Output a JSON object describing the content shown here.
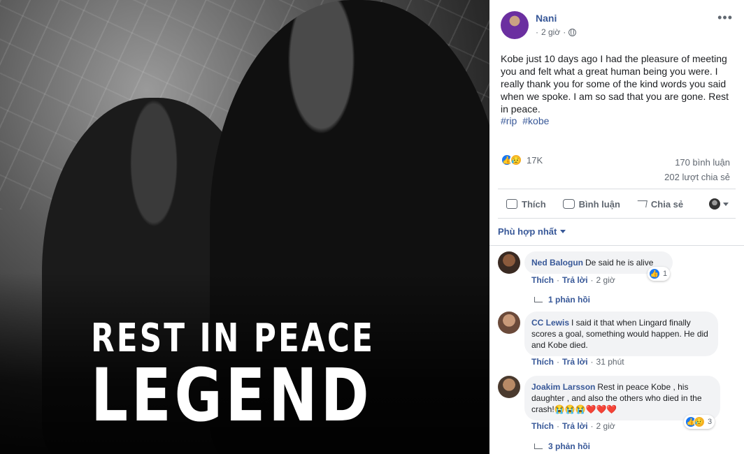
{
  "photo": {
    "line1": "REST IN PEACE",
    "line2": "LEGEND"
  },
  "post": {
    "author": "Nani",
    "time": "2 giờ",
    "more": "•••",
    "text": "Kobe just 10 days ago I had the pleasure of meeting you and felt what a great human being you were. I really thank you for some of the kind words you said when we spoke. I am so sad that you are gone. Rest in peace.",
    "hashtags": [
      "#rip",
      "#kobe"
    ],
    "reaction_count": "17K",
    "comment_count": "170 bình luận",
    "share_count": "202 lượt chia sẻ"
  },
  "actions": {
    "like": "Thích",
    "comment": "Bình luận",
    "share": "Chia sẻ"
  },
  "sort": {
    "label": "Phù hợp nhất"
  },
  "comments": [
    {
      "name": "Ned Balogun",
      "text": "De said he is alive",
      "like": "Thích",
      "reply": "Trả lời",
      "time": "2 giờ",
      "reaction_count": "1",
      "replies": "1 phản hồi"
    },
    {
      "name": "CC Lewis",
      "text": "I said it that when Lingard finally scores a goal, something would happen. He did and Kobe died.",
      "like": "Thích",
      "reply": "Trả lời",
      "time": "31 phút"
    },
    {
      "name": "Joakim Larsson",
      "text": "Rest in peace Kobe , his daughter , and also the others who died in the crash!😭😭😭❤️❤️❤️",
      "like": "Thích",
      "reply": "Trả lời",
      "time": "2 giờ",
      "reaction_count": "3",
      "replies": "3 phản hồi"
    }
  ],
  "colors": {
    "link": "#385898",
    "meta": "#606770",
    "like_blue": "#1877f2",
    "sad_yellow": "#f7b125",
    "bubble": "#f2f3f5"
  },
  "icons": [
    "globe-icon",
    "more-icon",
    "like-reaction-icon",
    "sad-reaction-icon",
    "thumb-icon",
    "comment-icon",
    "share-icon",
    "chevron-down-icon",
    "reply-arrow-icon"
  ]
}
